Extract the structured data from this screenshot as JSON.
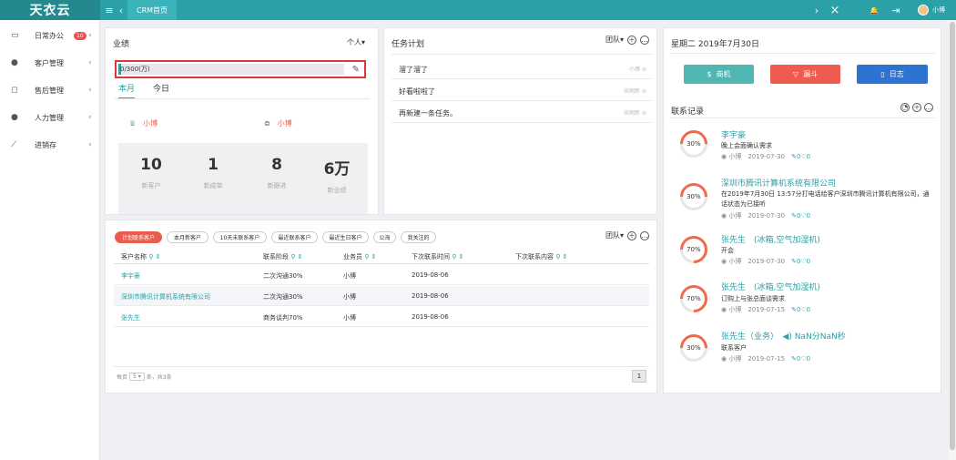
{
  "app": {
    "logo": "天衣云",
    "tab": "CRM首页",
    "user": "小博"
  },
  "topbar": {
    "menu_icon": "≡",
    "back_icon": "‹",
    "forward_icon": "›",
    "close_icon": "×",
    "bell_icon": "🔔",
    "exit_icon": "⇥"
  },
  "sidebar": {
    "items": [
      {
        "icon": "▭",
        "label": "日常办公",
        "badge": "10",
        "chevron": "‹"
      },
      {
        "icon": "●",
        "label": "客户管理",
        "chevron": "‹"
      },
      {
        "icon": "◻",
        "label": "售后管理",
        "chevron": "‹"
      },
      {
        "icon": "●",
        "label": "人力管理",
        "chevron": "‹"
      },
      {
        "icon": "⟋",
        "label": "进销存",
        "chevron": "‹"
      }
    ]
  },
  "performance": {
    "title": "业绩",
    "scope": "个人",
    "progress_text": "0/300(万)",
    "progress_fraction": 0.01,
    "tabs": [
      "本月",
      "今日"
    ],
    "leader_label": "小博",
    "person_label": "小博",
    "stats": [
      {
        "value": "10",
        "label": "新客户"
      },
      {
        "value": "1",
        "label": "新成单"
      },
      {
        "value": "8",
        "label": "新跟进"
      },
      {
        "value": "6万",
        "label": "新业绩"
      }
    ]
  },
  "tasks": {
    "title": "任务计划",
    "scope": "团队",
    "items": [
      {
        "text": "溜了溜了",
        "owner": "小博"
      },
      {
        "text": "好看啦啦了",
        "owner": "宋翔新"
      },
      {
        "text": "再新建一条任务。",
        "owner": "宋翔新"
      }
    ]
  },
  "date_header": "星期二 2019年7月30日",
  "actions": [
    {
      "label": "商机",
      "icon": "$",
      "color": "#4fb6b1"
    },
    {
      "label": "漏斗",
      "icon": "▽",
      "color": "#ef5b4f"
    },
    {
      "label": "日志",
      "icon": "▯",
      "color": "#2c73d2"
    }
  ],
  "customers": {
    "filters": [
      "计划联系客户",
      "本月新客户",
      "10天未联系客户",
      "最近联系客户",
      "最近生日客户",
      "公海",
      "我关注的"
    ],
    "scope": "团队",
    "columns": [
      "客户名称",
      "联系阶段",
      "业务员",
      "下次联系时间",
      "下次联系内容"
    ],
    "rows": [
      {
        "name": "李宇豪",
        "stage": "二次沟通30%",
        "rep": "小博",
        "next_time": "2019-08-06",
        "next_content": ""
      },
      {
        "name": "深圳市腾讯计算机系统有限公司",
        "stage": "二次沟通30%",
        "rep": "小博",
        "next_time": "2019-08-06",
        "next_content": ""
      },
      {
        "name": "张先生",
        "stage": "商务谈判70%",
        "rep": "小博",
        "next_time": "2019-08-06",
        "next_content": ""
      }
    ],
    "pagination": {
      "prefix": "每页",
      "page_size": "5",
      "suffix": "条，共3条",
      "current_page": "1"
    }
  },
  "records": {
    "title": "联系记录",
    "items": [
      {
        "percent": "30%",
        "fraction": 0.3,
        "name": "李宇豪",
        "text": "晚上会面确认需求",
        "user": "小博",
        "date": "2019-07-30",
        "counts": "0♡0"
      },
      {
        "percent": "30%",
        "fraction": 0.3,
        "name": "深圳市腾讯计算机系统有限公司",
        "text": "在2019年7月30日 13:57分打电话给客户深圳市腾讯计算机有限公司，通话状态为已接听",
        "user": "小博",
        "date": "2019-07-30",
        "counts": "0♡0"
      },
      {
        "percent": "70%",
        "fraction": 0.7,
        "name": "张先生　(冰箱,空气加湿机)",
        "text": "开会",
        "user": "小博",
        "date": "2019-07-30",
        "counts": "0♡0"
      },
      {
        "percent": "70%",
        "fraction": 0.7,
        "name": "张先生　(冰箱,空气加湿机)",
        "text": "订购上与张总面谈需求",
        "user": "小博",
        "date": "2019-07-15",
        "counts": "0♡0"
      },
      {
        "percent": "30%",
        "fraction": 0.3,
        "name": "张先生（业务）　◀) NaN分NaN秒",
        "text": "联系客户",
        "user": "小博",
        "date": "2019-07-15",
        "counts": "0♡0"
      }
    ]
  }
}
